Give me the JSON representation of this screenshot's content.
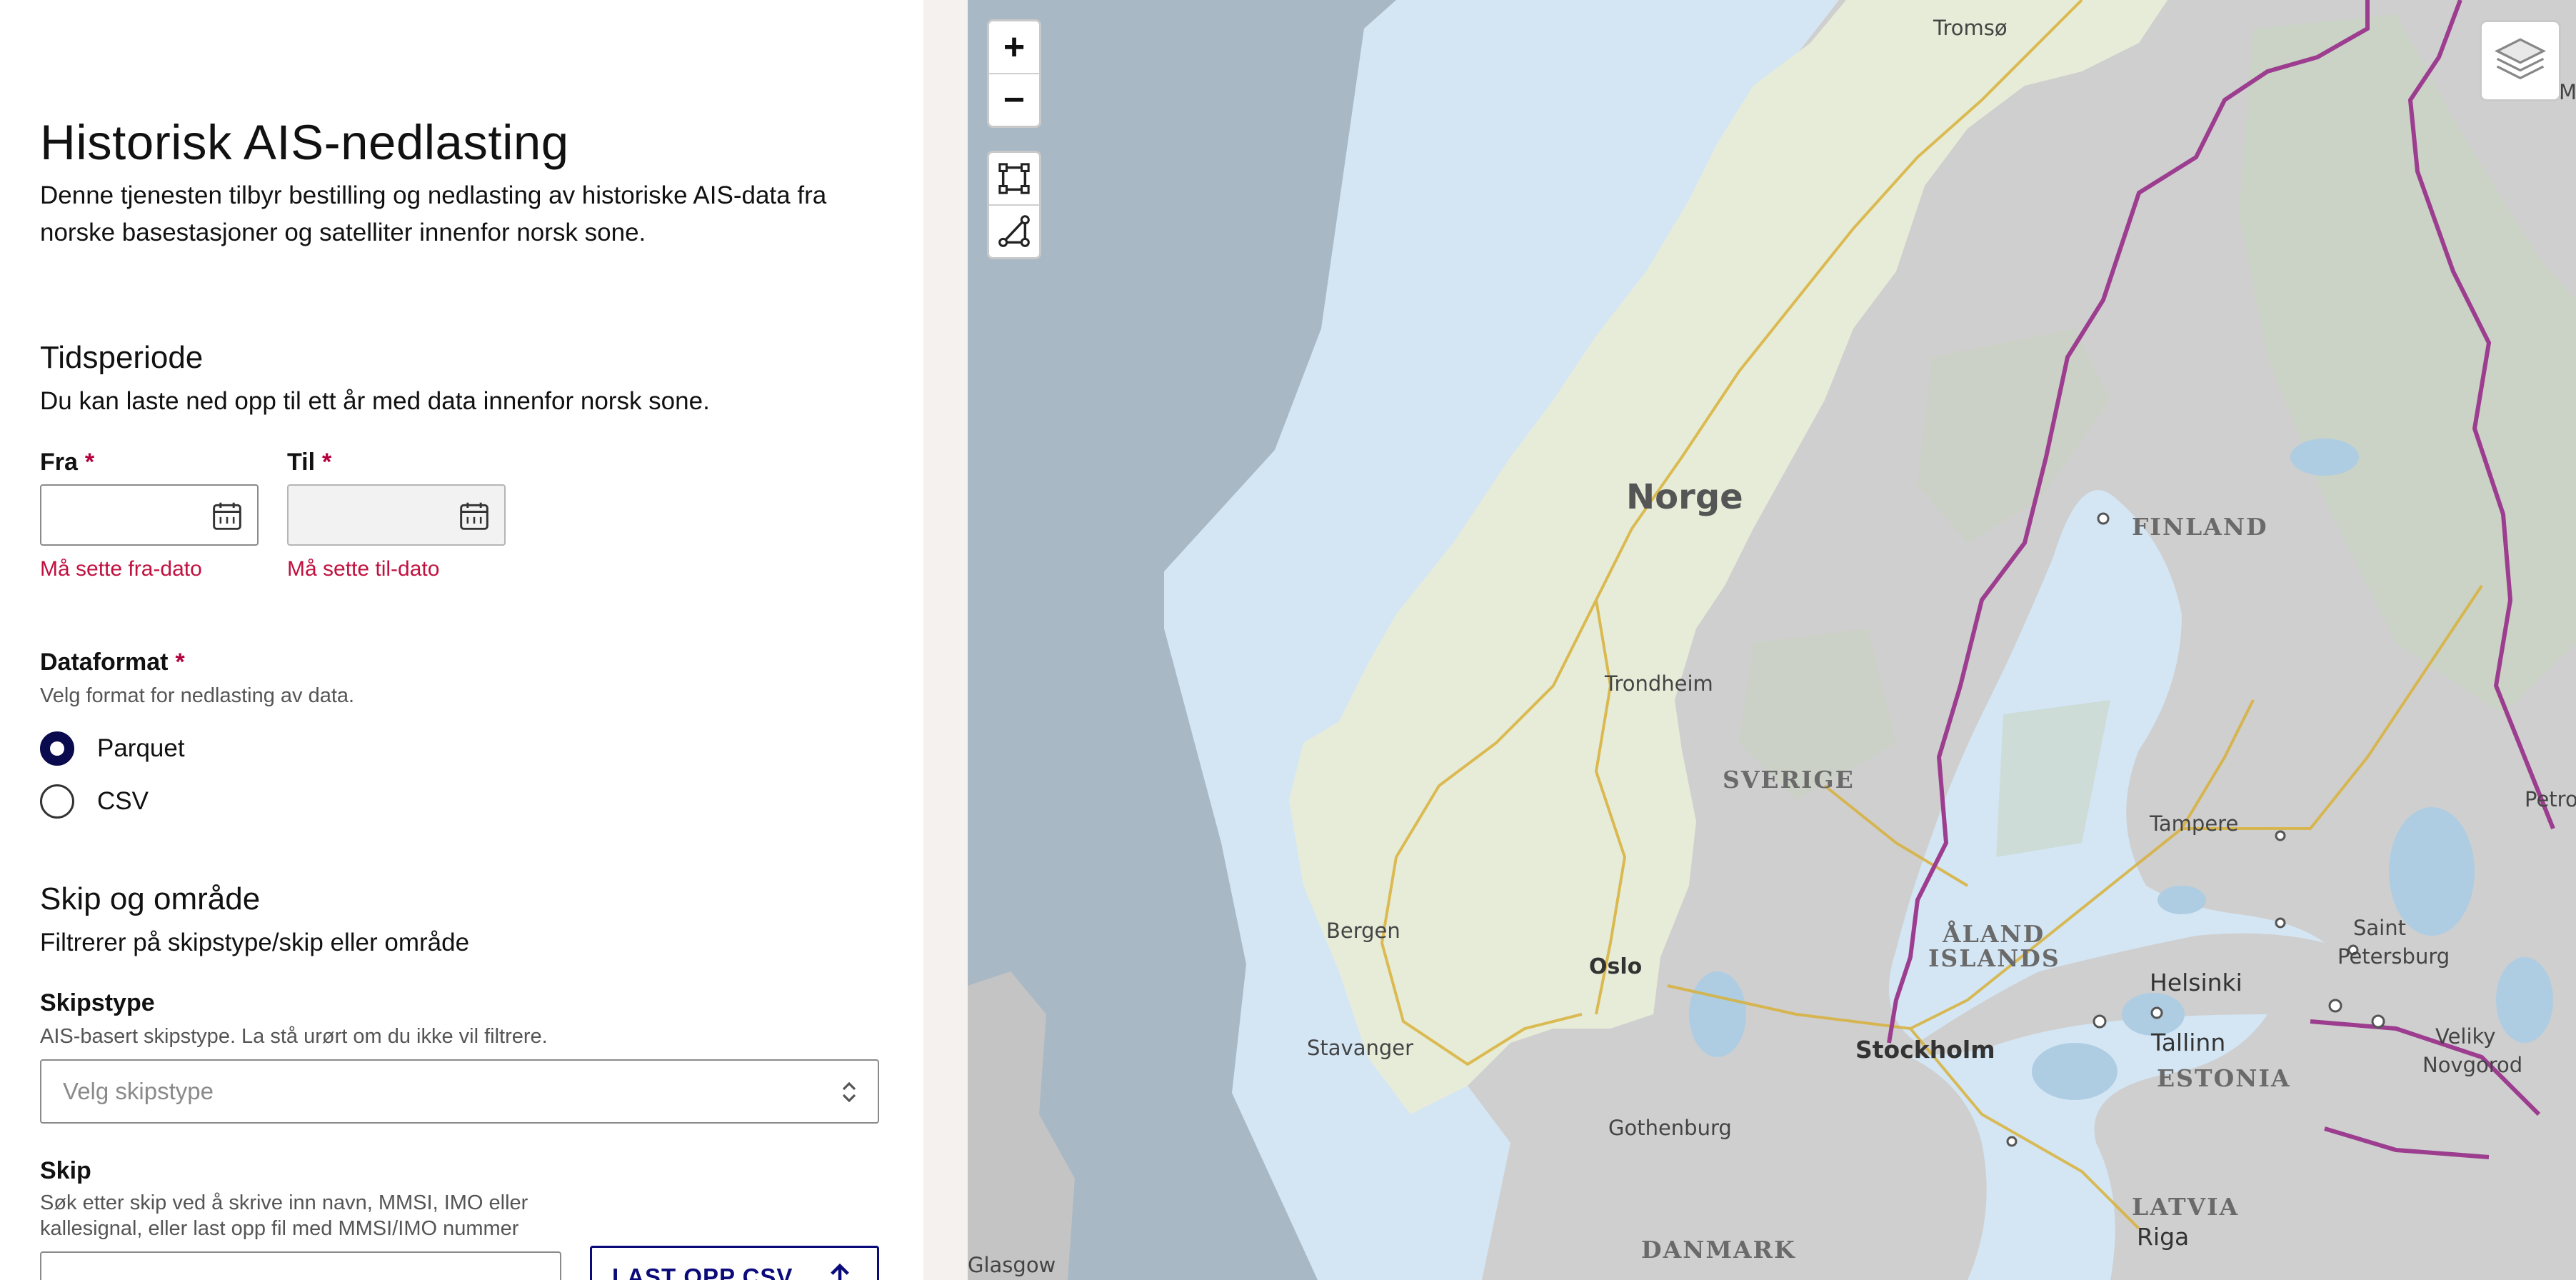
{
  "page": {
    "title": "Historisk AIS-nedlasting",
    "intro": "Denne tjenesten tilbyr bestilling og nedlasting av historiske AIS-data fra norske basestasjoner og satelliter innenfor norsk sone."
  },
  "period": {
    "heading": "Tidsperiode",
    "description": "Du kan laste ned opp til ett år med data innenfor norsk sone.",
    "from_label": "Fra",
    "to_label": "Til",
    "required_mark": "*",
    "from_value": "",
    "to_value": "",
    "from_error": "Må sette fra-dato",
    "to_error": "Må sette til-dato"
  },
  "format": {
    "label": "Dataformat",
    "required_mark": "*",
    "hint": "Velg format for nedlasting av data.",
    "options": [
      {
        "label": "Parquet",
        "selected": true
      },
      {
        "label": "CSV",
        "selected": false
      }
    ]
  },
  "ships": {
    "heading": "Skip og område",
    "description": "Filtrerer på skipstype/skip eller område",
    "type_label": "Skipstype",
    "type_hint": "AIS-basert skipstype. La stå urørt om du ikke vil filtrere.",
    "type_placeholder": "Velg skipstype",
    "ship_label": "Skip",
    "ship_hint_1": "Søk etter skip ved å skrive inn navn, MMSI, IMO eller",
    "ship_hint_2": "kallesignal, eller last opp fil med MMSI/IMO nummer",
    "upload_label": "LAST OPP CSV"
  },
  "map": {
    "zoom_in": "+",
    "zoom_out": "−",
    "icons": [
      "bbox-draw-icon",
      "polygon-draw-icon",
      "layers-icon"
    ],
    "labels": {
      "norge": "Norge",
      "finland": "FINLAND",
      "sverige": "SVERIGE",
      "aland": "ÅLAND",
      "islands": "ISLANDS",
      "estonia": "ESTONIA",
      "latvia": "LATVIA",
      "denmark": "DANMARK",
      "tromso": "Tromsø",
      "trondheim": "Trondheim",
      "bergen": "Bergen",
      "stavanger": "Stavanger",
      "oslo": "Oslo",
      "gothenburg": "Gothenburg",
      "stockholm": "Stockholm",
      "tampere": "Tampere",
      "helsinki": "Helsinki",
      "tallinn": "Tallinn",
      "riga": "Riga",
      "glasgow": "Glasgow",
      "saint": "Saint",
      "petersburg": "Petersburg",
      "veliky": "Veliky",
      "novgorod": "Novgorod",
      "petroz": "Petroz",
      "murmansk_partial": "M"
    },
    "colors": {
      "sea": "#d4e6f4",
      "outer_sea": "#a9b8c5",
      "land": "#cfcfcf",
      "norway": "#e7ecd9",
      "border": "#9c3d8f",
      "roads": "#d8b13a",
      "lakes": "#aecde3"
    }
  }
}
